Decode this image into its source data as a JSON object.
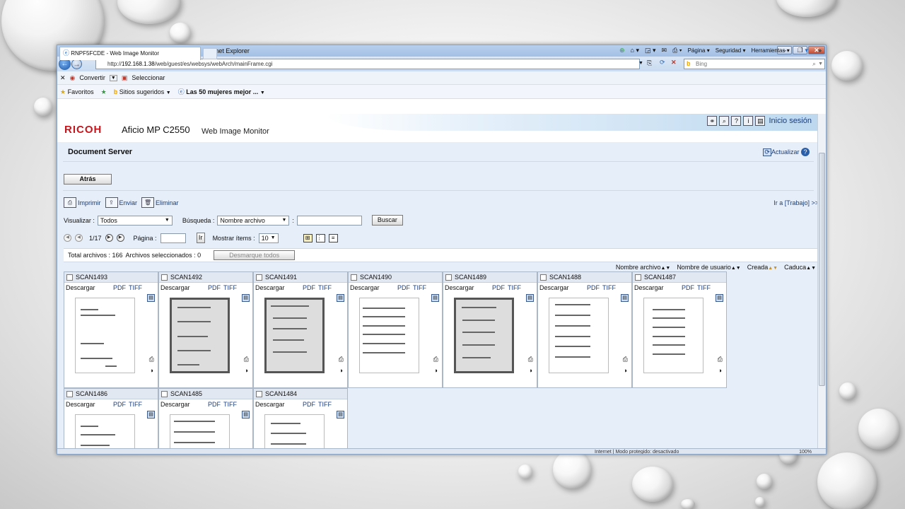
{
  "window": {
    "title": "RNPF5FCDE - Web Image Monitor - Windows Internet Explorer"
  },
  "address": {
    "url_prefix": "http://",
    "host": "192.168.1.38",
    "path": "/web/guest/es/websys/webArch/mainFrame.cgi",
    "search_placeholder": "Bing"
  },
  "commandbar": {
    "convert": "Convertir",
    "select": "Seleccionar"
  },
  "favorites": {
    "favorites": "Favoritos",
    "suggested": "Sitios sugeridos",
    "link": "Las 50 mujeres mejor ..."
  },
  "tab": {
    "title": "RNPF5FCDE - Web Image Monitor",
    "page": "Página",
    "security": "Seguridad",
    "tools": "Herramientas"
  },
  "header": {
    "logo": "RICOH",
    "model": "Aficio MP C2550",
    "product": "Web Image Monitor",
    "login": "Inicio sesión"
  },
  "docserver": {
    "title": "Document Server",
    "refresh": "Actualizar",
    "back": "Atrás"
  },
  "actions": {
    "print": "Imprimir",
    "send": "Enviar",
    "delete": "Eliminar",
    "goto_job": "Ir a [Trabajo] >>"
  },
  "filters": {
    "view_label": "Visualizar :",
    "view_value": "Todos",
    "search_label": "Búsqueda :",
    "search_field": "Nombre archivo",
    "colon": ":",
    "search_button": "Buscar"
  },
  "pager": {
    "page_info": "1/17",
    "page_label": "Página :",
    "go": "Ir",
    "show_label": "Mostrar ítems :",
    "show_value": "10"
  },
  "totals": {
    "total": "Total archivos : 166",
    "selected": "Archivos seleccionados : 0",
    "unselect_all": "Desmarque todos"
  },
  "sort": {
    "name": "Nombre archivo",
    "user": "Nombre de usuario",
    "created": "Creada",
    "expires": "Caduca"
  },
  "card_labels": {
    "download": "Descargar",
    "pdf": "PDF",
    "tiff": "TIFF"
  },
  "files": [
    {
      "name": "SCAN1493"
    },
    {
      "name": "SCAN1492"
    },
    {
      "name": "SCAN1491"
    },
    {
      "name": "SCAN1490"
    },
    {
      "name": "SCAN1489"
    },
    {
      "name": "SCAN1488"
    },
    {
      "name": "SCAN1487"
    },
    {
      "name": "SCAN1486"
    },
    {
      "name": "SCAN1485"
    },
    {
      "name": "SCAN1484"
    }
  ],
  "status": {
    "text": "Internet | Modo protegido: desactivado",
    "zoom": "100%"
  }
}
